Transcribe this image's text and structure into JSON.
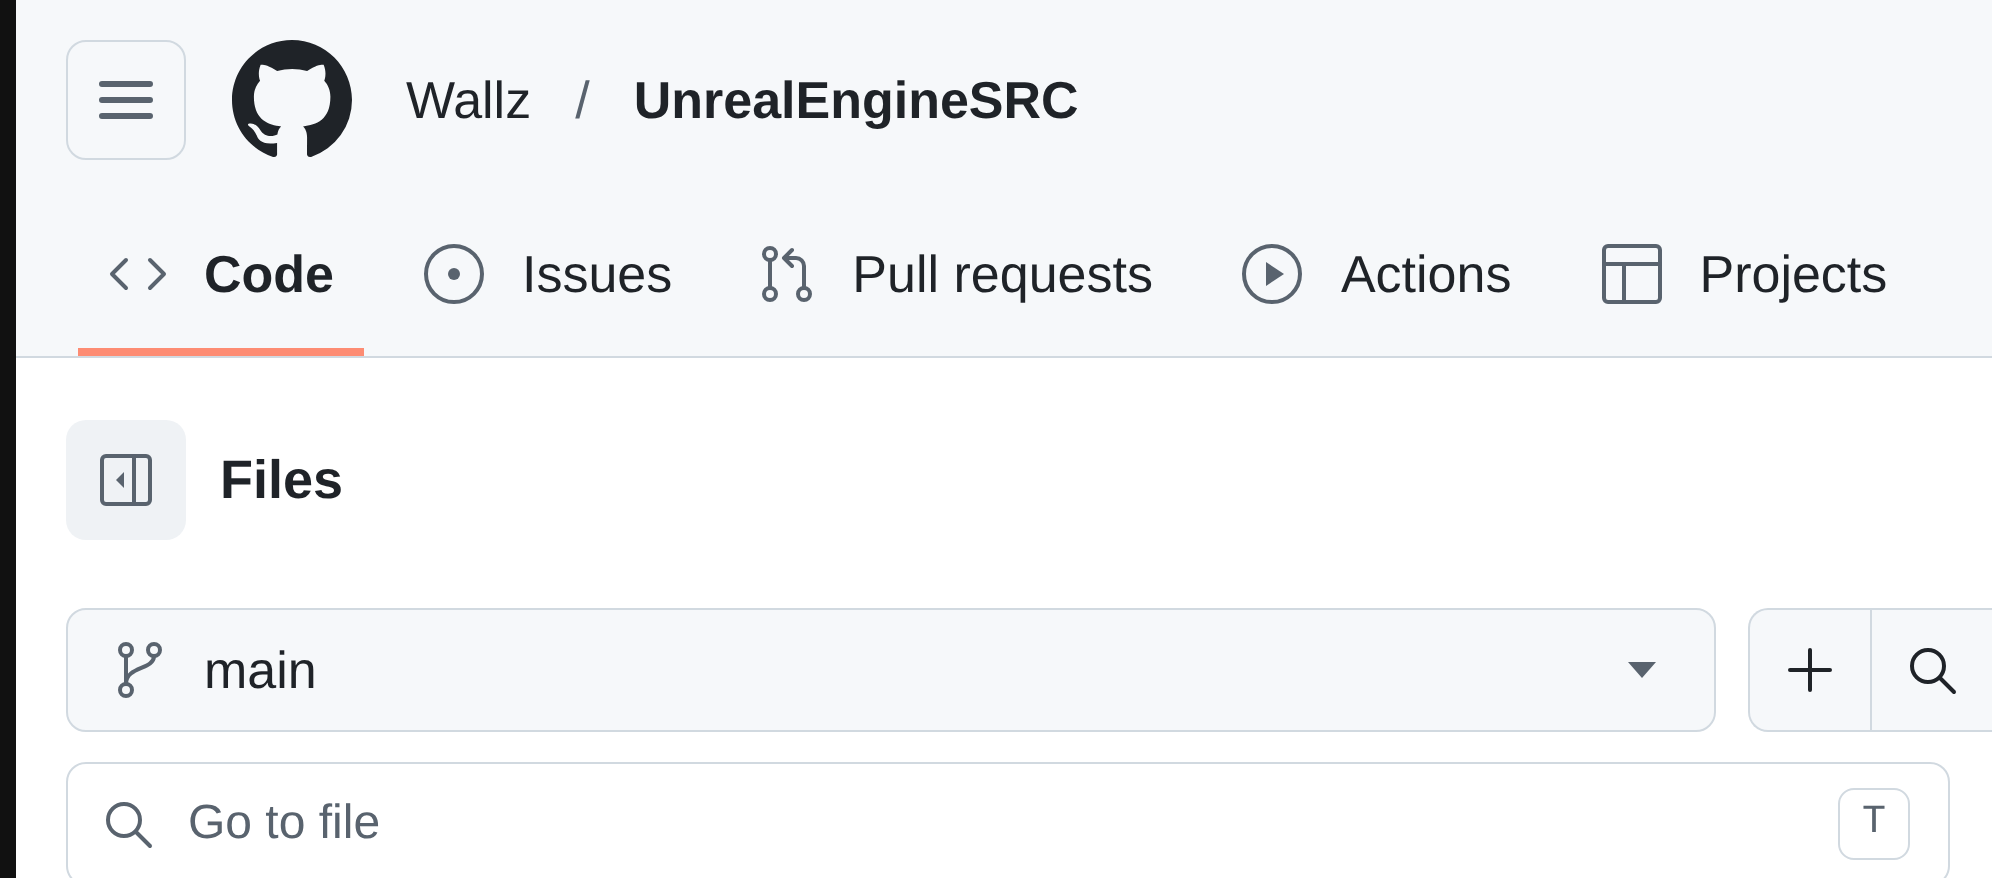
{
  "header": {
    "owner": "Wallz",
    "separator": "/",
    "repo": "UnrealEngineSRC"
  },
  "tabs": [
    {
      "kind": "code",
      "label": "Code",
      "selected": true
    },
    {
      "kind": "issues",
      "label": "Issues",
      "selected": false
    },
    {
      "kind": "pulls",
      "label": "Pull requests",
      "selected": false
    },
    {
      "kind": "actions",
      "label": "Actions",
      "selected": false
    },
    {
      "kind": "projects",
      "label": "Projects",
      "selected": false
    }
  ],
  "files": {
    "title": "Files",
    "branch": "main",
    "search": {
      "placeholder": "Go to file",
      "shortcut": "T"
    }
  }
}
